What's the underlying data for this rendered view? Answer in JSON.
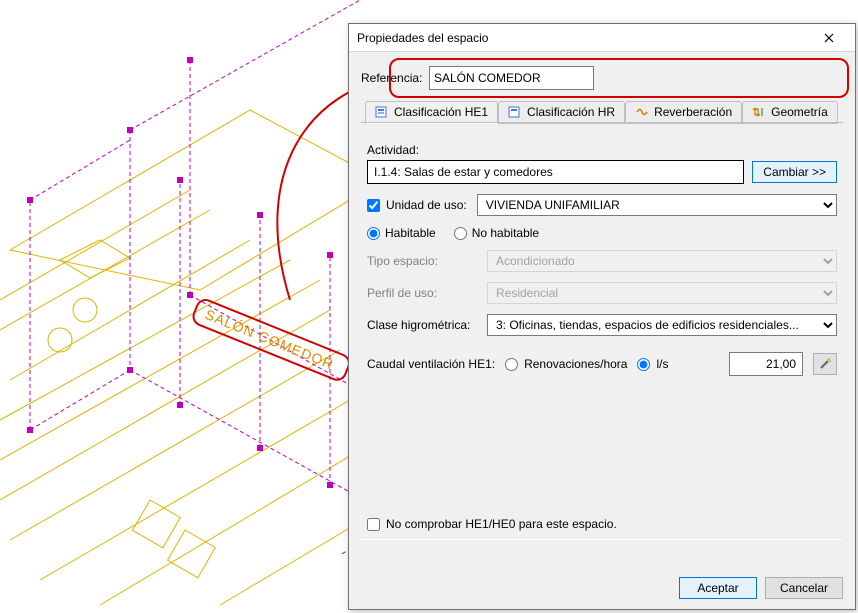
{
  "dialog": {
    "title": "Propiedades del espacio",
    "reference_label": "Referencia:",
    "reference_value": "SALÓN COMEDOR",
    "tabs": [
      {
        "label": "Clasificación HE1",
        "icon": "classify-he1-icon"
      },
      {
        "label": "Clasificación HR",
        "icon": "classify-hr-icon"
      },
      {
        "label": "Reverberación",
        "icon": "reverb-icon"
      },
      {
        "label": "Geometría",
        "icon": "geometry-icon"
      }
    ],
    "activity_label": "Actividad:",
    "activity_value": "I.1.4: Salas de estar y comedores",
    "change_btn": "Cambiar >>",
    "unit_label": "Unidad de uso:",
    "unit_value": "VIVIENDA UNIFAMILIAR",
    "habitable": "Habitable",
    "no_habitable": "No habitable",
    "tipo_espacio_label": "Tipo espacio:",
    "tipo_espacio_value": "Acondicionado",
    "perfil_label": "Perfil de uso:",
    "perfil_value": "Residencial",
    "clase_label": "Clase higrométrica:",
    "clase_value": "3: Oficinas, tiendas, espacios de edificios residenciales...",
    "caudal_label": "Caudal ventilación HE1:",
    "renov": "Renovaciones/hora",
    "ls": "l/s",
    "caudal_value": "21,00",
    "no_check_label": "No comprobar HE1/HE0 para este espacio.",
    "accept": "Aceptar",
    "cancel": "Cancelar"
  },
  "annotation": {
    "label": "SALÓN COMEDOR"
  }
}
